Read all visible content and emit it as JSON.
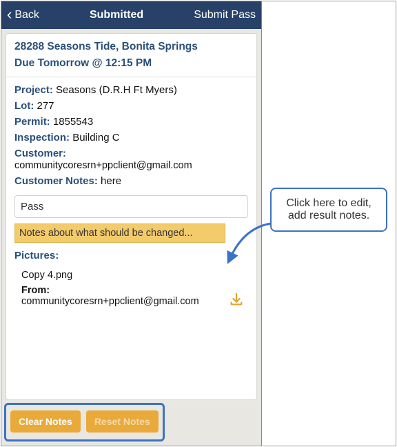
{
  "nav": {
    "back": "Back",
    "title": "Submitted",
    "right": "Submit Pass"
  },
  "head": {
    "address": "28288 Seasons Tide, Bonita Springs",
    "due": "Due Tomorrow @ 12:15 PM"
  },
  "labels": {
    "project": "Project:",
    "lot": "Lot:",
    "permit": "Permit:",
    "inspection": "Inspection:",
    "customer": "Customer:",
    "cnotes": "Customer Notes:",
    "pictures": "Pictures:",
    "from": "From:"
  },
  "values": {
    "project": "Seasons (D.R.H Ft Myers)",
    "lot": "277",
    "permit": "1855543",
    "inspection": "Building C",
    "customer_email": "communitycoresrn+ppclient@gmail.com",
    "cnotes": "here",
    "result": "Pass",
    "notes_placeholder": "Notes about what should be changed...",
    "picture_name": "Copy 4.png",
    "picture_from": "communitycoresrn+ppclient@gmail.com"
  },
  "buttons": {
    "clear": "Clear Notes",
    "reset": "Reset Notes"
  },
  "callout": {
    "l1": "Click here to edit,",
    "l2": "add result notes."
  }
}
